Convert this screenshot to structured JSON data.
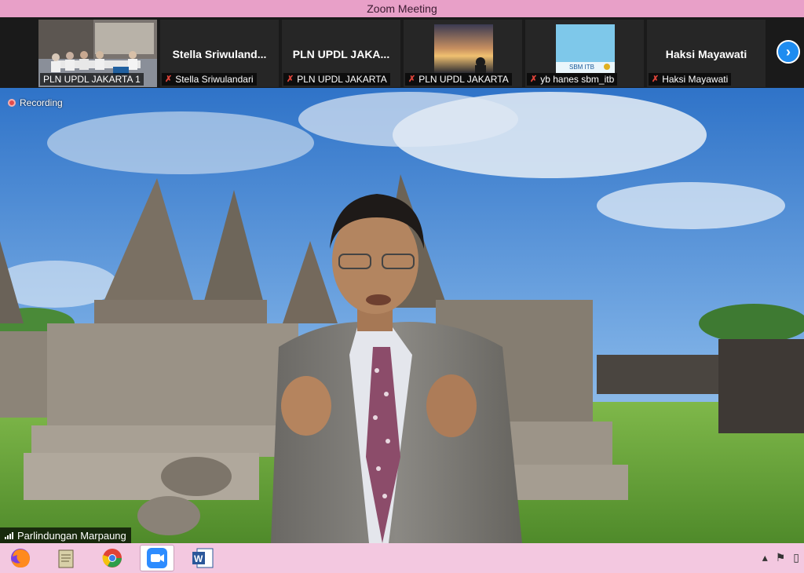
{
  "window": {
    "title": "Zoom Meeting"
  },
  "participants": [
    {
      "display": "",
      "label": "PLN UPDL JAKARTA 1",
      "muted": false,
      "type": "video-room"
    },
    {
      "display": "Stella  Sriwuland...",
      "label": "Stella Sriwulandari",
      "muted": true,
      "type": "name"
    },
    {
      "display": "PLN UPDL JAKA...",
      "label": "PLN UPDL JAKARTA",
      "muted": true,
      "type": "name"
    },
    {
      "display": "",
      "label": "PLN UPDL JAKARTA",
      "muted": true,
      "type": "video-sunset"
    },
    {
      "display": "",
      "label": "yb hanes sbm_itb",
      "muted": true,
      "type": "logo"
    },
    {
      "display": "Haksi Mayawati",
      "label": "Haksi Mayawati",
      "muted": true,
      "type": "name"
    }
  ],
  "logo_text": "SBM ITB",
  "strip": {
    "next_icon": "chevron-right-icon"
  },
  "stage": {
    "recording_label": "Recording",
    "speaker_name": "Parlindungan Marpaung"
  },
  "taskbar": {
    "apps": [
      "firefox-icon",
      "notes-icon",
      "chrome-icon",
      "zoom-icon",
      "word-icon"
    ],
    "active": "zoom-icon",
    "tray": [
      "chevron-up-icon",
      "flag-icon",
      "network-icon"
    ]
  },
  "colors": {
    "titlebar": "#e8a0c8",
    "taskbar": "#f3c8e0",
    "muted_mic": "#e0443a",
    "zoom_blue": "#1e8cf0",
    "recording_red": "#e34b4b"
  }
}
